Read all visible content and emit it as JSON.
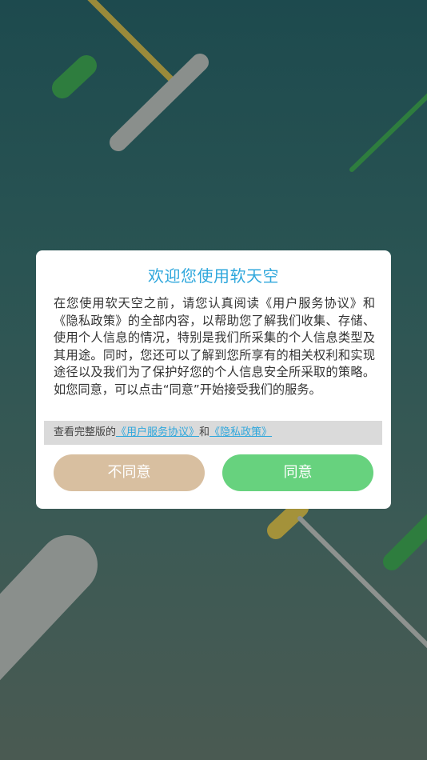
{
  "dialog": {
    "title": "欢迎您使用软天空",
    "body": "在您使用软天空之前，请您认真阅读《用户服务协议》和《隐私政策》的全部内容，以帮助您了解我们收集、存储、使用个人信息的情况，特别是我们所采集的个人信息类型及其用途。同时，您还可以了解到您所享有的相关权利和实现途径以及我们为了保护好您的个人信息安全所采取的策略。如您同意，可以点击“同意”开始接受我们的服务。",
    "links_prefix": "查看完整版的",
    "user_agreement_link": "《用户服务协议》",
    "links_conjunction": "和",
    "privacy_policy_link": "《隐私政策》",
    "disagree_label": "不同意",
    "agree_label": "同意"
  },
  "colors": {
    "title": "#2fa7dc",
    "link": "#2fa7dc",
    "disagree_button": "#d8bfa0",
    "agree_button": "#67d27e",
    "background_top": "#1d4a4e",
    "background_bottom": "#4a5a52"
  }
}
